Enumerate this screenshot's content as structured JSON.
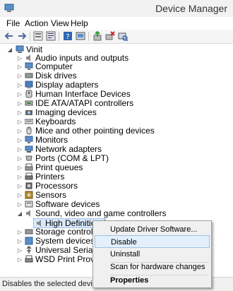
{
  "window": {
    "title": "Device Manager"
  },
  "menubar": {
    "items": [
      "File",
      "Action",
      "View",
      "Help"
    ]
  },
  "toolbar": {
    "buttons": [
      "back-icon",
      "forward-icon",
      "show-hide-icon",
      "properties-icon",
      "help-icon",
      "device-properties-icon",
      "update-driver-icon",
      "uninstall-icon",
      "scan-hardware-icon"
    ]
  },
  "tree": {
    "root": "Vinit",
    "items": [
      "Audio inputs and outputs",
      "Computer",
      "Disk drives",
      "Display adapters",
      "Human Interface Devices",
      "IDE ATA/ATAPI controllers",
      "Imaging devices",
      "Keyboards",
      "Mice and other pointing devices",
      "Monitors",
      "Network adapters",
      "Ports (COM & LPT)",
      "Print queues",
      "Printers",
      "Processors",
      "Sensors",
      "Software devices",
      "Sound, video and game controllers",
      "High Definition A",
      "Storage controllers",
      "System devices",
      "Universal Serial Bus c",
      "WSD Print Provider"
    ]
  },
  "context_menu": {
    "items": [
      "Update Driver Software...",
      "Disable",
      "Uninstall",
      "Scan for hardware changes",
      "Properties"
    ],
    "highlighted": "Disable"
  },
  "statusbar": {
    "text": "Disables the selected device."
  },
  "colors": {
    "selection": "#d9e8fb",
    "menu_highlight": "#e3effa",
    "titlebar": "#f2f2f2"
  }
}
